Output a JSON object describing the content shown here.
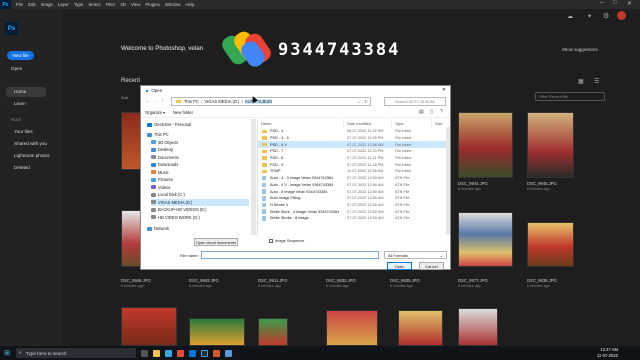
{
  "menubar": {
    "app_logo": "Ps",
    "items": [
      "File",
      "Edit",
      "Image",
      "Layer",
      "Type",
      "Select",
      "Filter",
      "3D",
      "View",
      "Plugins",
      "Window",
      "Help"
    ]
  },
  "left": {
    "new_file": "New file",
    "open": "Open",
    "home": "Home",
    "learn": "Learn",
    "files_header": "FILES",
    "your_files": "Your files",
    "shared": "Shared with you",
    "lightroom": "Lightroom photos",
    "deleted": "Deleted"
  },
  "main": {
    "welcome": "Welcome to Photoshop, velan",
    "show_suggestions": "Show suggestions",
    "recent": "Recent",
    "sort": "Sort",
    "filter_placeholder": "Filter Recent file"
  },
  "overlay": {
    "phone": "9344743384"
  },
  "thumbs_row1": [
    {
      "name": "DSC_9944.JPG",
      "time": "6 minutes ago"
    },
    {
      "name": "DSC_9945.JPG",
      "time": "6 minutes ago"
    }
  ],
  "thumbs_row2": [
    {
      "name": "DSC_9946.JPG",
      "time": "6 minutes ago"
    },
    {
      "name": "DSC_9943.JPG",
      "time": "6 minutes ago"
    },
    {
      "name": "DSC_9911.JPG",
      "time": "6 minutes ago"
    },
    {
      "name": "DSC_9832.JPG",
      "time": "6 minutes ago"
    },
    {
      "name": "DSC_9935.JPG",
      "time": "6 minutes ago"
    },
    {
      "name": "DSC_9977.JPG",
      "time": "6 minutes ago"
    },
    {
      "name": "DSC_9838.JPG",
      "time": "6 minutes ago"
    }
  ],
  "dialog": {
    "title": "Open",
    "path": [
      "This PC",
      "VIGAS MEDIA (D:)",
      "AUTO ALBUM"
    ],
    "search_placeholder": "Search AUTO ALBUM",
    "organize": "Organize ▾",
    "new_folder": "New folder",
    "tree": [
      {
        "label": "OneDrive - Personal",
        "color": "#0078d4"
      },
      {
        "label": "This PC",
        "color": "#3d8fd6"
      },
      {
        "label": "3D Objects",
        "color": "#4a9fe0"
      },
      {
        "label": "Desktop",
        "color": "#3d8fd6"
      },
      {
        "label": "Documents",
        "color": "#7e8fa3"
      },
      {
        "label": "Downloads",
        "color": "#2b88d8"
      },
      {
        "label": "Music",
        "color": "#e0823d"
      },
      {
        "label": "Pictures",
        "color": "#4a9fe0"
      },
      {
        "label": "Videos",
        "color": "#7b5bd6"
      },
      {
        "label": "Local Disk (C:)",
        "color": "#888888"
      },
      {
        "label": "VIGAS MEDIA (D:)",
        "color": "#888888"
      },
      {
        "label": "BACKUP-HD VIDEOS (E:)",
        "color": "#888888"
      },
      {
        "label": "HD VIDEO WORK (G:)",
        "color": "#888888"
      },
      {
        "label": "Network",
        "color": "#3d8fd6"
      }
    ],
    "columns": [
      "Name",
      "Date modified",
      "Type",
      "Size"
    ],
    "files": [
      {
        "name": "PSD - 4",
        "date": "06-07-2022 11:32 PM",
        "type": "File folder",
        "folder": true
      },
      {
        "name": "PSD - 4 - 5",
        "date": "07-07-2022 11:35 PM",
        "type": "File folder",
        "folder": true
      },
      {
        "name": "PSD - 6 V",
        "date": "07-07-2022 12:56 AM",
        "type": "File folder",
        "folder": true,
        "selected": true
      },
      {
        "name": "PSD - 7",
        "date": "07-07-2022 11:20 PM",
        "type": "File folder",
        "folder": true
      },
      {
        "name": "PSD - 8",
        "date": "07-07-2022 11:21 PM",
        "type": "File folder",
        "folder": true
      },
      {
        "name": "PSD - 9",
        "date": "07-07-2022 11:26 PM",
        "type": "File folder",
        "folder": true
      },
      {
        "name": "TEMP",
        "date": "11-07-2022 12:56 AM",
        "type": "File folder",
        "folder": true
      },
      {
        "name": "Auto - 4 - 3 image Velan 9344743384",
        "date": "07-07-2022 12:50 AM",
        "type": "ATN File",
        "folder": false
      },
      {
        "name": "Auto - 4 V - image Velan 9344743384",
        "date": "07-07-2022 12:56 AM",
        "type": "ATN File",
        "folder": false
      },
      {
        "name": "Auto - 8 image Velan 9344743384",
        "date": "07-07-2022 12:50 AM",
        "type": "ATN File",
        "folder": false
      },
      {
        "name": "Auto Image Filling",
        "date": "07-07-2022 12:50 AM",
        "type": "ATN File",
        "folder": false
      },
      {
        "name": "H Stroke 4",
        "date": "07-07-2022 12:50 AM",
        "type": "ATN File",
        "folder": false
      },
      {
        "name": "White Stork - 4 image Velan 9344743384",
        "date": "07-07-2022 12:50 AM",
        "type": "ATN File",
        "folder": false
      },
      {
        "name": "White Stroke - 8 image",
        "date": "07-07-2022 12:50 AM",
        "type": "ATN File",
        "folder": false
      }
    ],
    "open_cloud": "Open cloud documents",
    "image_sequence": "Image Sequence",
    "file_name_label": "File name:",
    "file_name_value": "",
    "format": "All Formats",
    "open": "Open",
    "cancel": "Cancel"
  },
  "taskbar": {
    "search": "Type here to search",
    "time": "12:47 AM",
    "date": "11-07-2022"
  }
}
